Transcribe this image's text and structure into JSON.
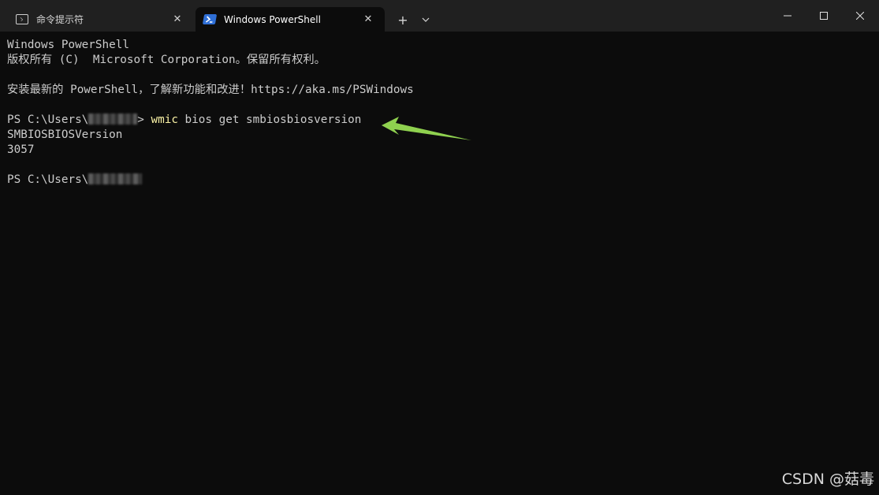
{
  "tabs": [
    {
      "label": "命令提示符",
      "icon": "command-prompt-icon",
      "active": false
    },
    {
      "label": "Windows PowerShell",
      "icon": "powershell-icon",
      "active": true
    }
  ],
  "tabbar": {
    "new_tab": "+",
    "close": "✕"
  },
  "terminal": {
    "header_line_1": "Windows PowerShell",
    "header_line_2": "版权所有 (C)  Microsoft Corporation。保留所有权利。",
    "install_line": "安装最新的 PowerShell，了解新功能和改进！https://aka.ms/PSWindows",
    "prompt_prefix": "PS C:\\Users\\",
    "prompt_suffix": ">",
    "command_name": "wmic",
    "command_args": " bios get smbiosbiosversion",
    "output_header": "SMBIOSBIOSVersion",
    "output_value": "3057",
    "second_prompt_prefix": "PS C:\\Users\\"
  },
  "annotation": {
    "arrow_color": "#8fd14f"
  },
  "watermark": "CSDN @菇毒",
  "colors": {
    "background": "#0c0c0c",
    "titlebar": "#202020",
    "text": "#cccccc",
    "command_highlight": "#f9f1a5"
  }
}
